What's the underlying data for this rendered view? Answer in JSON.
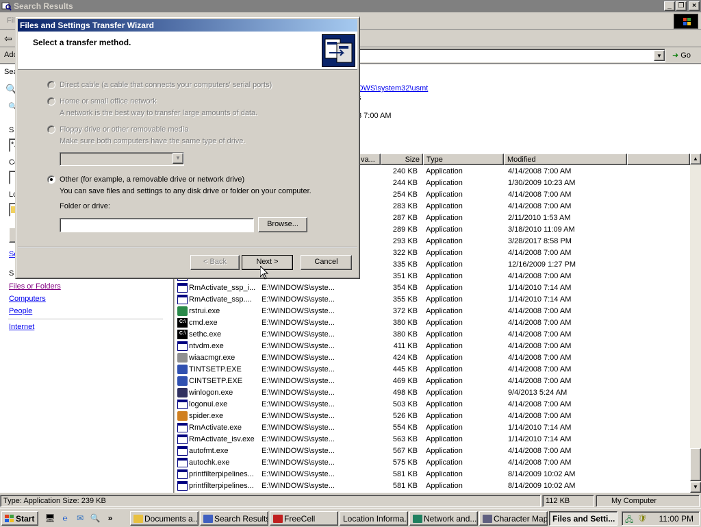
{
  "explorer": {
    "title": "Search Results",
    "menu_fragment": "Fil",
    "address_label": "Add",
    "go_label": "Go",
    "location": {
      "path_link": "OWS\\system32\\usmt",
      "fragment_1": "s",
      "fragment_2": "8 7:00 AM"
    },
    "left_pane": {
      "snip_sea": "Sea",
      "snip_s1": "S",
      "snip_star": "*.",
      "snip_co": "Co",
      "snip_lo": "Lo",
      "snip_se": "Se",
      "snip_s2": "S",
      "links": {
        "files_or_folders": "Files or Folders",
        "computers": "Computers",
        "people": "People",
        "internet": "Internet"
      }
    },
    "columns": {
      "in_folder": "va...",
      "size": "Size",
      "type": "Type",
      "modified": "Modified"
    },
    "rows": [
      {
        "name": "",
        "folder": "",
        "size": "240 KB",
        "type": "Application",
        "modified": "4/14/2008 7:00 AM",
        "icon": "app"
      },
      {
        "name": "",
        "folder": "",
        "size": "244 KB",
        "type": "Application",
        "modified": "1/30/2009 10:23 AM",
        "icon": "app"
      },
      {
        "name": "",
        "folder": "",
        "size": "254 KB",
        "type": "Application",
        "modified": "4/14/2008 7:00 AM",
        "icon": "app"
      },
      {
        "name": "",
        "folder": "",
        "size": "283 KB",
        "type": "Application",
        "modified": "4/14/2008 7:00 AM",
        "icon": "app"
      },
      {
        "name": "",
        "folder": "",
        "size": "287 KB",
        "type": "Application",
        "modified": "2/11/2010 1:53 AM",
        "icon": "app"
      },
      {
        "name": "",
        "folder": "",
        "size": "289 KB",
        "type": "Application",
        "modified": "3/18/2010 11:09 AM",
        "icon": "app"
      },
      {
        "name": "",
        "folder": "",
        "size": "293 KB",
        "type": "Application",
        "modified": "3/28/2017 8:58 PM",
        "icon": "app"
      },
      {
        "name": "",
        "folder": "",
        "size": "322 KB",
        "type": "Application",
        "modified": "4/14/2008 7:00 AM",
        "icon": "app"
      },
      {
        "name": "",
        "folder": "",
        "size": "335 KB",
        "type": "Application",
        "modified": "12/16/2009 1:27 PM",
        "icon": "app"
      },
      {
        "name": "",
        "folder": "",
        "size": "351 KB",
        "type": "Application",
        "modified": "4/14/2008 7:00 AM",
        "icon": "app"
      },
      {
        "name": "RmActivate_ssp_i...",
        "folder": "E:\\WINDOWS\\syste...",
        "size": "354 KB",
        "type": "Application",
        "modified": "1/14/2010 7:14 AM",
        "icon": "app"
      },
      {
        "name": "RmActivate_ssp....",
        "folder": "E:\\WINDOWS\\syste...",
        "size": "355 KB",
        "type": "Application",
        "modified": "1/14/2010 7:14 AM",
        "icon": "app"
      },
      {
        "name": "rstrui.exe",
        "folder": "E:\\WINDOWS\\syste...",
        "size": "372 KB",
        "type": "Application",
        "modified": "4/14/2008 7:00 AM",
        "icon": "restore"
      },
      {
        "name": "cmd.exe",
        "folder": "E:\\WINDOWS\\syste...",
        "size": "380 KB",
        "type": "Application",
        "modified": "4/14/2008 7:00 AM",
        "icon": "cmd"
      },
      {
        "name": "sethc.exe",
        "folder": "E:\\WINDOWS\\syste...",
        "size": "380 KB",
        "type": "Application",
        "modified": "4/14/2008 7:00 AM",
        "icon": "cmd"
      },
      {
        "name": "ntvdm.exe",
        "folder": "E:\\WINDOWS\\syste...",
        "size": "411 KB",
        "type": "Application",
        "modified": "4/14/2008 7:00 AM",
        "icon": "app"
      },
      {
        "name": "wiaacmgr.exe",
        "folder": "E:\\WINDOWS\\syste...",
        "size": "424 KB",
        "type": "Application",
        "modified": "4/14/2008 7:00 AM",
        "icon": "scanner"
      },
      {
        "name": "TINTSETP.EXE",
        "folder": "E:\\WINDOWS\\syste...",
        "size": "445 KB",
        "type": "Application",
        "modified": "4/14/2008 7:00 AM",
        "icon": "setup"
      },
      {
        "name": "CINTSETP.EXE",
        "folder": "E:\\WINDOWS\\syste...",
        "size": "469 KB",
        "type": "Application",
        "modified": "4/14/2008 7:00 AM",
        "icon": "setup"
      },
      {
        "name": "winlogon.exe",
        "folder": "E:\\WINDOWS\\syste...",
        "size": "498 KB",
        "type": "Application",
        "modified": "9/4/2013 5:24 AM",
        "icon": "winlogon"
      },
      {
        "name": "logonui.exe",
        "folder": "E:\\WINDOWS\\syste...",
        "size": "503 KB",
        "type": "Application",
        "modified": "4/14/2008 7:00 AM",
        "icon": "app"
      },
      {
        "name": "spider.exe",
        "folder": "E:\\WINDOWS\\syste...",
        "size": "526 KB",
        "type": "Application",
        "modified": "4/14/2008 7:00 AM",
        "icon": "spider"
      },
      {
        "name": "RmActivate.exe",
        "folder": "E:\\WINDOWS\\syste...",
        "size": "554 KB",
        "type": "Application",
        "modified": "1/14/2010 7:14 AM",
        "icon": "app"
      },
      {
        "name": "RmActivate_isv.exe",
        "folder": "E:\\WINDOWS\\syste...",
        "size": "563 KB",
        "type": "Application",
        "modified": "1/14/2010 7:14 AM",
        "icon": "app"
      },
      {
        "name": "autofmt.exe",
        "folder": "E:\\WINDOWS\\syste...",
        "size": "567 KB",
        "type": "Application",
        "modified": "4/14/2008 7:00 AM",
        "icon": "app"
      },
      {
        "name": "autochk.exe",
        "folder": "E:\\WINDOWS\\syste...",
        "size": "575 KB",
        "type": "Application",
        "modified": "4/14/2008 7:00 AM",
        "icon": "app"
      },
      {
        "name": "printfilterpipelines...",
        "folder": "E:\\WINDOWS\\syste...",
        "size": "581 KB",
        "type": "Application",
        "modified": "8/14/2009 10:02 AM",
        "icon": "app"
      },
      {
        "name": "printfilterpipelines...",
        "folder": "E:\\WINDOWS\\syste...",
        "size": "581 KB",
        "type": "Application",
        "modified": "8/14/2009 10:02 AM",
        "icon": "app"
      }
    ],
    "status": {
      "info": "Type: Application Size: 239 KB",
      "size": "112 KB",
      "zone": "My Computer"
    }
  },
  "dialog": {
    "title": "Files and Settings Transfer Wizard",
    "heading": "Select a transfer method.",
    "options": {
      "direct_cable": "Direct cable (a cable that connects your computers' serial ports)",
      "home_network": "Home or small office network",
      "home_network_desc": "A network is the best way to transfer large amounts of data.",
      "floppy": "Floppy drive or other removable media",
      "floppy_desc": "Make sure both computers have the same type of drive.",
      "other": "Other (for example, a removable drive or network drive)",
      "other_desc": "You can save files and settings to any disk drive or folder on your computer."
    },
    "folder_label": "Folder or drive:",
    "folder_value": "",
    "selected_option": "other",
    "buttons": {
      "browse": "Browse...",
      "back": "< Back",
      "next": "Next >",
      "cancel": "Cancel"
    }
  },
  "taskbar": {
    "start_label": "Start",
    "quick_launch": [
      "show-desktop-icon",
      "internet-explorer-icon",
      "outlook-express-icon",
      "search-icon"
    ],
    "more_label": "»",
    "tasks": [
      {
        "label": "Documents a...",
        "icon_color": "#e8c040"
      },
      {
        "label": "Search Results",
        "icon_color": "#4060c0"
      },
      {
        "label": "FreeCell",
        "icon_color": "#c02020"
      },
      {
        "label": "Location Informa...",
        "icon_color": ""
      },
      {
        "label": "Network and...",
        "icon_color": "#208060"
      },
      {
        "label": "Character Map",
        "icon_color": "#606080"
      },
      {
        "label": "Files and Setti...",
        "icon_color": "",
        "active": true
      }
    ],
    "clock": "11:00 PM"
  },
  "colors": {
    "title_active": "#0a246a",
    "title_inactive": "#808080",
    "link": "#0000ee",
    "visited_link": "#800080"
  }
}
